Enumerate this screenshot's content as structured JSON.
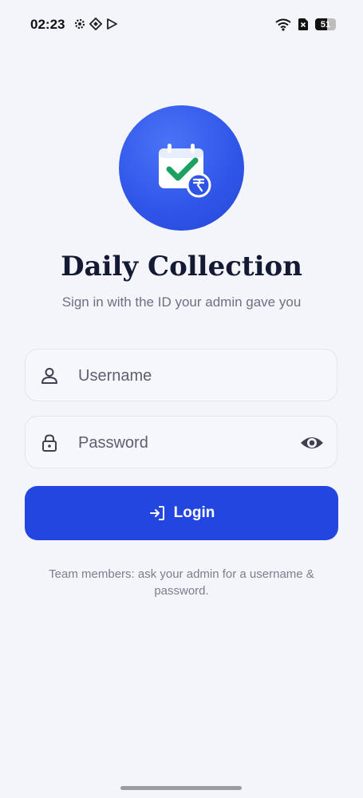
{
  "status_bar": {
    "time": "02:23",
    "battery": "51"
  },
  "app": {
    "title": "Daily Collection",
    "subtitle": "Sign in with the ID your admin gave you"
  },
  "form": {
    "username_placeholder": "Username",
    "username_value": "",
    "password_placeholder": "Password",
    "password_value": "",
    "login_label": "Login"
  },
  "hint": "Team members: ask your admin for a username & password.",
  "colors": {
    "primary": "#2446e0",
    "background": "#f4f5fb",
    "check_green": "#1aa260"
  },
  "icons": {
    "logo": "calendar-check-rupee-icon",
    "username": "user-icon",
    "password": "lock-icon",
    "toggle": "eye-icon",
    "login": "login-arrow-icon"
  }
}
